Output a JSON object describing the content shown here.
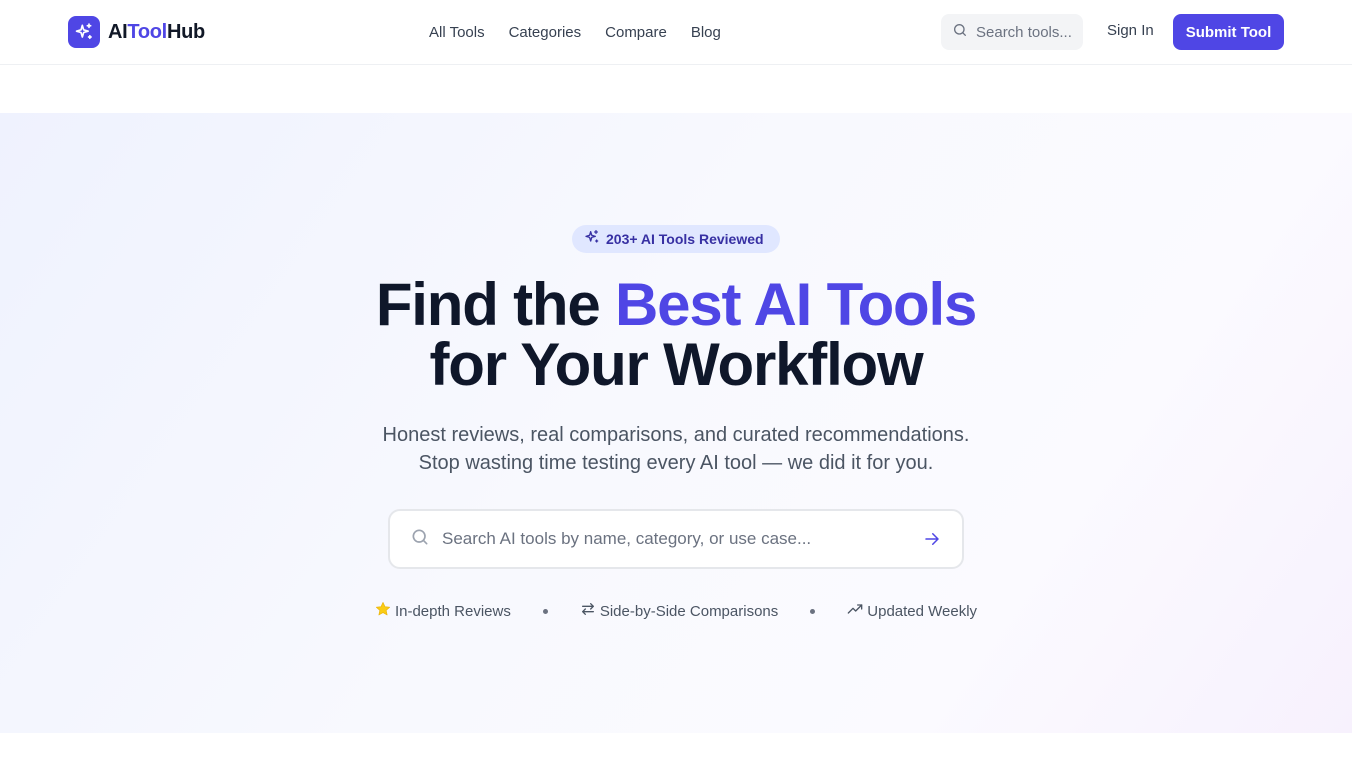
{
  "brand": {
    "part1": "AI",
    "part2": "Tool",
    "part3": "Hub",
    "accent_color": "#4f46e5",
    "icon": "sparkles-icon"
  },
  "nav": {
    "links": [
      "All Tools",
      "Categories",
      "Compare",
      "Blog"
    ],
    "search_placeholder": "Search tools...",
    "sign_in": "Sign In",
    "submit": "Submit Tool"
  },
  "hero": {
    "badge": "203+ AI Tools Reviewed",
    "headline_part1": "Find the ",
    "headline_accent": "Best AI Tools",
    "headline_part2": "for Your Workflow",
    "subtitle_line1": "Honest reviews, real comparisons, and curated recommendations.",
    "subtitle_line2": "Stop wasting time testing every AI tool — we did it for you.",
    "search_placeholder": "Search AI tools by name, category, or use case...",
    "features": [
      {
        "icon": "star-icon",
        "label": "In-depth Reviews"
      },
      {
        "icon": "swap-arrows-icon",
        "label": "Side-by-Side Comparisons"
      },
      {
        "icon": "trending-up-icon",
        "label": "Updated Weekly"
      }
    ]
  }
}
